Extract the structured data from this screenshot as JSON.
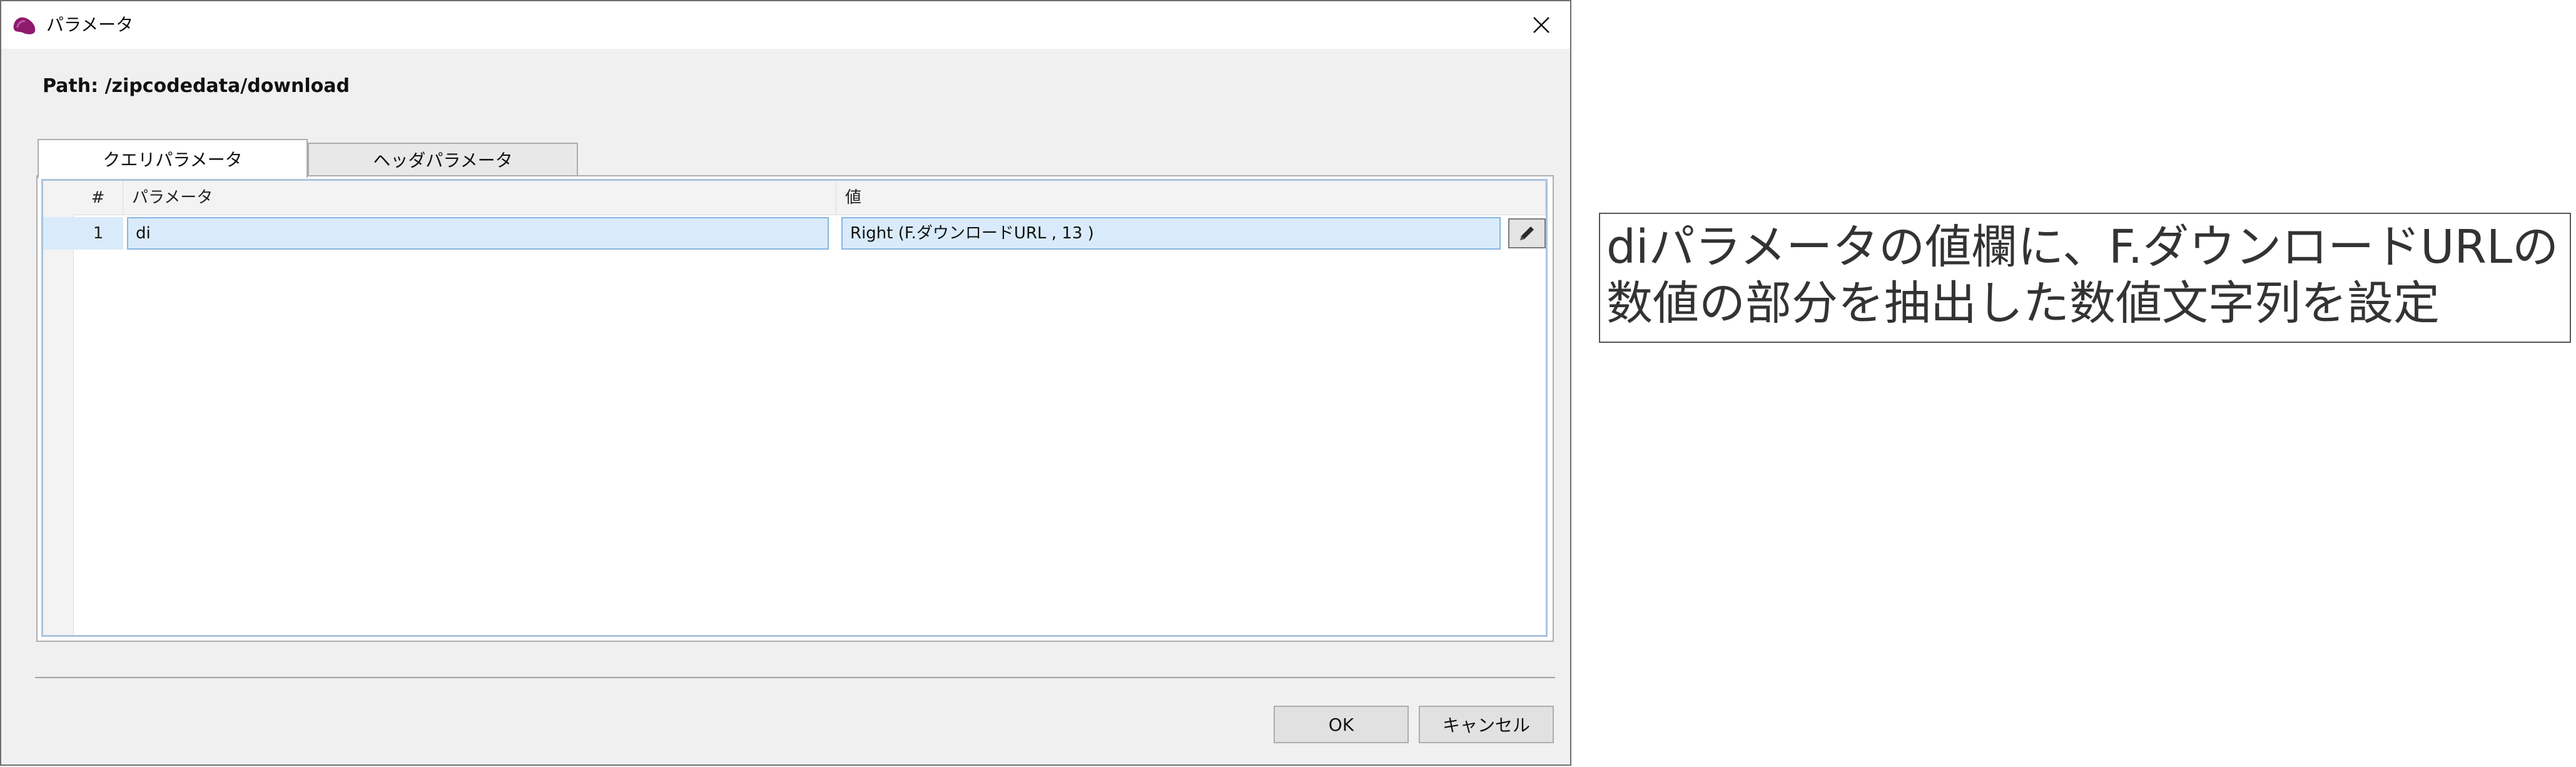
{
  "window": {
    "title": "パラメータ",
    "icon": "app-logo-icon",
    "close_icon": "close-icon"
  },
  "path_label": "Path: /zipcodedata/download",
  "tabs": [
    {
      "label": "クエリパラメータ",
      "selected": true
    },
    {
      "label": "ヘッダパラメータ",
      "selected": false
    }
  ],
  "grid": {
    "columns": [
      "#",
      "パラメータ",
      "値"
    ],
    "rows": [
      {
        "num": "1",
        "param": "di",
        "value": "Right (F.ダウンロードURL , 13 )"
      }
    ],
    "edit_icon": "pencil-icon"
  },
  "buttons": {
    "ok": "OK",
    "cancel": "キャンセル"
  },
  "annotation": "diパラメータの値欄に、F.ダウンロードURLの\n数値の部分を抽出した数値文字列を設定",
  "colors": {
    "accent_icon": "#8e1a6e",
    "selection": "#d9ebfa",
    "selection_border": "#86b6e0"
  }
}
